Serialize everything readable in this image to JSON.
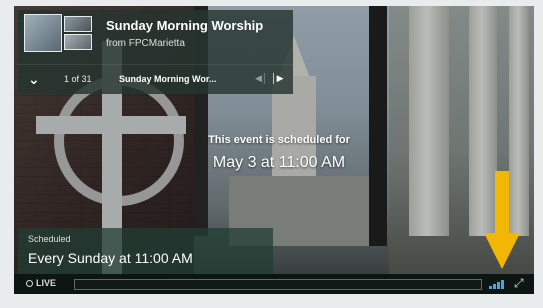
{
  "event": {
    "title": "Sunday Morning Worship",
    "from": "from FPCMarietta"
  },
  "playlist": {
    "count": "1 of 31",
    "title": "Sunday Morning Wor...",
    "expand_icon": "chevron-down-icon",
    "prev_icon": "skip-previous-icon",
    "next_icon": "skip-next-icon"
  },
  "message": {
    "line1": "This event is scheduled for",
    "line2": "May 3 at 11:00 AM"
  },
  "schedule": {
    "label": "Scheduled",
    "value": "Every Sunday at 11:00 AM"
  },
  "controls": {
    "live_label": "LIVE",
    "quality_icon": "signal-bars-icon",
    "fullscreen_icon": "fullscreen-icon"
  },
  "colors": {
    "accent_blue": "#4aa3e6",
    "arrow": "#f2b705"
  }
}
